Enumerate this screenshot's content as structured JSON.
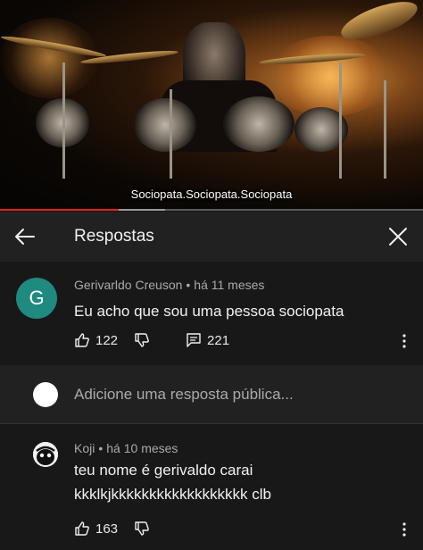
{
  "video": {
    "caption": "Sociopata.Sociopata.Sociopata",
    "progress_played": 0.28,
    "progress_buffered": 0.39
  },
  "header": {
    "title": "Respostas",
    "back_icon": "arrow-left-icon",
    "close_icon": "close-icon"
  },
  "parent_comment": {
    "avatar_letter": "G",
    "avatar_color": "#1e8a80",
    "author": "Gerivarldo Creuson",
    "separator": "•",
    "time": "há 11 meses",
    "text": "Eu acho que sou uma pessoa sociopata",
    "likes": "122",
    "replies": "221"
  },
  "reply_input": {
    "placeholder": "Adicione uma resposta pública..."
  },
  "reply": {
    "author": "Koji",
    "separator": "•",
    "time": "há 10 meses",
    "text_line1": "teu nome é gerivaldo carai",
    "text_line2": "kkklkjkkkkkkkkkkkkkkkkkk clb",
    "likes": "163"
  },
  "colors": {
    "accent_progress": "#e62117",
    "background": "#181818",
    "header": "#212121"
  }
}
